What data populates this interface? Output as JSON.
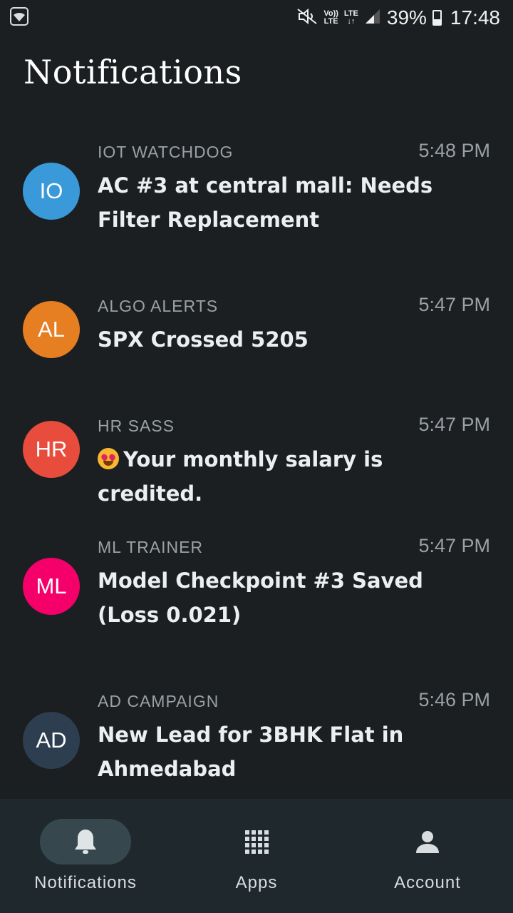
{
  "status_bar": {
    "volte_top": "Vo))",
    "volte_bottom": "LTE",
    "lte_top": "LTE",
    "lte_bottom": "↓↑",
    "battery_percent": "39%",
    "battery_level": 0.39,
    "time": "17:48",
    "icons": [
      "wifi-icon",
      "mute-icon",
      "volte-icon",
      "lte-icon",
      "signal-icon",
      "battery-icon"
    ]
  },
  "page": {
    "title": "Notifications"
  },
  "notifications": [
    {
      "initials": "IO",
      "color": "#3a9ad9",
      "sender": "IOT WATCHDOG",
      "time": "5:48 PM",
      "message": "AC #3 at central mall: Needs Filter Replacement",
      "emoji": ""
    },
    {
      "initials": "AL",
      "color": "#e67e22",
      "sender": "ALGO ALERTS",
      "time": "5:47 PM",
      "message": "SPX Crossed 5205",
      "emoji": ""
    },
    {
      "initials": "HR",
      "color": "#e74c3c",
      "sender": "HR SASS",
      "time": "5:47 PM",
      "message": "Your monthly salary is credited.",
      "emoji": "heart-eyes-emoji"
    },
    {
      "initials": "ML",
      "color": "#f5006a",
      "sender": "ML TRAINER",
      "time": "5:47 PM",
      "message": "Model Checkpoint #3 Saved (Loss 0.021)",
      "emoji": ""
    },
    {
      "initials": "AD",
      "color": "#2c3e50",
      "sender": "AD CAMPAIGN",
      "time": "5:46 PM",
      "message": "New Lead for 3BHK Flat in Ahmedabad",
      "emoji": ""
    }
  ],
  "bottom_nav": {
    "items": [
      {
        "label": "Notifications",
        "icon": "bell-icon",
        "active": true
      },
      {
        "label": "Apps",
        "icon": "apps-grid-icon",
        "active": false
      },
      {
        "label": "Account",
        "icon": "account-icon",
        "active": false
      }
    ]
  }
}
